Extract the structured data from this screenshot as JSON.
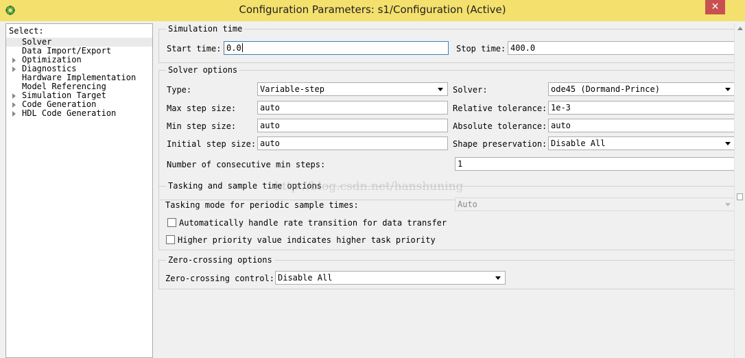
{
  "window": {
    "title": "Configuration Parameters: s1/Configuration (Active)",
    "close_glyph": "✕"
  },
  "tree": {
    "header": "Select:",
    "items": [
      {
        "label": "Solver",
        "expandable": false,
        "selected": true
      },
      {
        "label": "Data Import/Export",
        "expandable": false
      },
      {
        "label": "Optimization",
        "expandable": true
      },
      {
        "label": "Diagnostics",
        "expandable": true
      },
      {
        "label": "Hardware Implementation",
        "expandable": false
      },
      {
        "label": "Model Referencing",
        "expandable": false
      },
      {
        "label": "Simulation Target",
        "expandable": true
      },
      {
        "label": "Code Generation",
        "expandable": true
      },
      {
        "label": "HDL Code Generation",
        "expandable": true
      }
    ]
  },
  "simulation_time": {
    "title": "Simulation time",
    "start_label": "Start time:",
    "start_value": "0.0",
    "stop_label": "Stop time:",
    "stop_value": "400.0"
  },
  "solver_options": {
    "title": "Solver options",
    "type_label": "Type:",
    "type_value": "Variable-step",
    "solver_label": "Solver:",
    "solver_value": "ode45 (Dormand-Prince)",
    "max_step_label": "Max step size:",
    "max_step_value": "auto",
    "rel_tol_label": "Relative tolerance:",
    "rel_tol_value": "1e-3",
    "min_step_label": "Min step size:",
    "min_step_value": "auto",
    "abs_tol_label": "Absolute tolerance:",
    "abs_tol_value": "auto",
    "init_step_label": "Initial step size:",
    "init_step_value": "auto",
    "shape_label": "Shape preservation:",
    "shape_value": "Disable All",
    "consec_label": "Number of consecutive min steps:",
    "consec_value": "1"
  },
  "tasking": {
    "title": "Tasking and sample time options",
    "mode_label": "Tasking mode for periodic sample times:",
    "mode_value": "Auto",
    "auto_rate_label": "Automatically handle rate transition for data transfer",
    "auto_rate_checked": false,
    "priority_label": "Higher priority value indicates higher task priority",
    "priority_checked": false
  },
  "zero_crossing": {
    "title": "Zero-crossing options",
    "control_label": "Zero-crossing control:",
    "control_value": "Disable All"
  },
  "watermark": "http://blog.csdn.net/hanshuning",
  "colors": {
    "titlebar": "#f4e06c",
    "close_button": "#c75050",
    "focus_border": "#3c7fb1"
  }
}
